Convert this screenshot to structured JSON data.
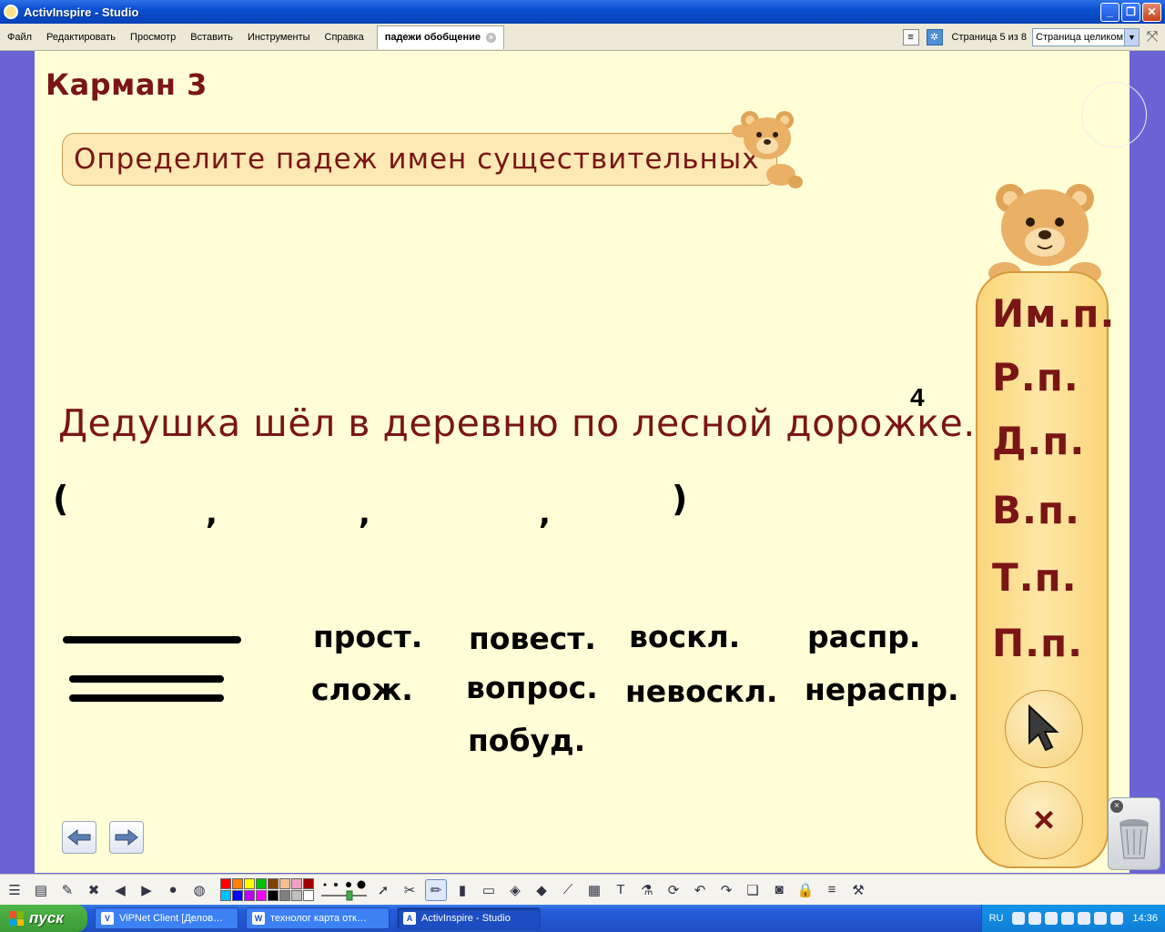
{
  "window": {
    "title": "ActivInspire - Studio"
  },
  "menu": {
    "items": [
      "Файл",
      "Редактировать",
      "Просмотр",
      "Вставить",
      "Инструменты",
      "Справка"
    ],
    "doc_tab": "падежи обобщение",
    "page_indicator": "Страница 5 из 8",
    "zoom_value": "Страница целиком"
  },
  "slide": {
    "pocket_title": "Карман 3",
    "task": "Определите падеж имен существительных",
    "sentence": "Дедушка шёл в деревню по лесной дорожке.",
    "superscript": "4",
    "paren_open": "(",
    "paren_close": ")",
    "comma": ",",
    "words": {
      "prost": "прост.",
      "slozh": "слож.",
      "povest": "повест.",
      "vopros": "вопрос.",
      "pobud": "побуд.",
      "voskl": "воскл.",
      "nevoskl": "невоскл.",
      "raspr": "распр.",
      "neraspr": "нераспр."
    },
    "cases": [
      "Им.п.",
      "Р.п.",
      "Д.п.",
      "В.п.",
      "Т.п.",
      "П.п."
    ],
    "close_symbol": "×"
  },
  "palette_colors": [
    "#ff0000",
    "#ff8000",
    "#ffff00",
    "#00c000",
    "#804000",
    "#f4c090",
    "#f0a0c0",
    "#a00000",
    "#00c0ff",
    "#0000ff",
    "#c000ff",
    "#ff00ff",
    "#000000",
    "#808080",
    "#c0c0c0",
    "#ffffff"
  ],
  "taskbar": {
    "start_label": "пуск",
    "tasks": [
      {
        "label": "ViPNet Client [Делов…",
        "icon": "vipnet-icon"
      },
      {
        "label": "технолог карта отк…",
        "icon": "word-icon"
      },
      {
        "label": "ActivInspire - Studio",
        "icon": "activinspire-icon"
      }
    ],
    "language": "RU",
    "clock": "14:36"
  },
  "colors": {
    "accent_text": "#7a1515",
    "page_bg": "#fffed6",
    "panel_bg": "#fbd57a"
  }
}
